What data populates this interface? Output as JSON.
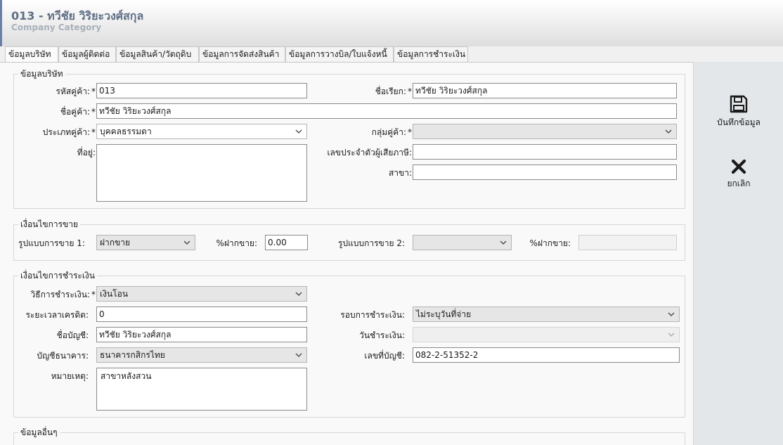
{
  "header": {
    "title": "013 - ทวีชัย วิริยะวงศ์สกุล",
    "subtitle": "Company Category"
  },
  "tabs": [
    {
      "label": "ข้อมูลบริษัท",
      "active": true
    },
    {
      "label": "ข้อมูลผู้ติดต่อ"
    },
    {
      "label": "ข้อมูลสินค้า/วัตถุดิบ"
    },
    {
      "label": "ข้อมูลการจัดส่งสินค้า"
    },
    {
      "label": "ข้อมูลการวางบิล/ใบแจ้งหนี้"
    },
    {
      "label": "ข้อมูลการชำระเงิน"
    }
  ],
  "actions": {
    "save_label": "บันทึกข้อมูล",
    "cancel_label": "ยกเลิก"
  },
  "company": {
    "legend": "ข้อมูลบริษัท",
    "customer_code_label": "รหัสคู่ค้า:",
    "customer_code": "013",
    "short_name_label": "ชื่อเรียก:",
    "short_name": "ทวีชัย วิริยะวงศ์สกุล",
    "customer_name_label": "ชื่อคู่ค้า:",
    "customer_name": "ทวีชัย วิริยะวงศ์สกุล",
    "customer_type_label": "ประเภทคู่ค้า:",
    "customer_type": "บุคคลธรรมดา",
    "customer_group_label": "กลุ่มคู่ค้า:",
    "customer_group": "",
    "address_label": "ที่อยู่:",
    "address": "",
    "tax_id_label": "เลขประจำตัวผู้เสียภาษี:",
    "tax_id": "",
    "branch_label": "สาขา:",
    "branch": "",
    "required_mark": "*"
  },
  "sales": {
    "legend": "เงื่อนไขการขาย",
    "sale_type1_label": "รูปแบบการขาย 1:",
    "sale_type1": "ฝากขาย",
    "consign_pct1_label": "%ฝากขาย:",
    "consign_pct1": "0.00",
    "sale_type2_label": "รูปแบบการขาย 2:",
    "sale_type2": "",
    "consign_pct2_label": "%ฝากขาย:",
    "consign_pct2": ""
  },
  "payment": {
    "legend": "เงื่อนไขการชำระเงิน",
    "method_label": "วิธีการชำระเงิน:",
    "method": "เงินโอน",
    "credit_term_label": "ระยะเวลาเครดิต:",
    "credit_term": "0",
    "payment_cycle_label": "รอบการชำระเงิน:",
    "payment_cycle": "ไม่ระบุวันที่จ่าย",
    "account_name_label": "ชื่อบัญชี:",
    "account_name": "ทวีชัย วิริยะวงศ์สกุล",
    "payment_day_label": "วันชำระเงิน:",
    "payment_day": "",
    "bank_label": "บัญชีธนาคาร:",
    "bank": "ธนาคารกสิกรไทย",
    "account_no_label": "เลขที่บัญชี:",
    "account_no": "082-2-51352-2",
    "note_label": "หมายเหตุ:",
    "note": "สาขาหลังสวน"
  },
  "other": {
    "legend": "ข้อมูลอื่นๆ"
  }
}
